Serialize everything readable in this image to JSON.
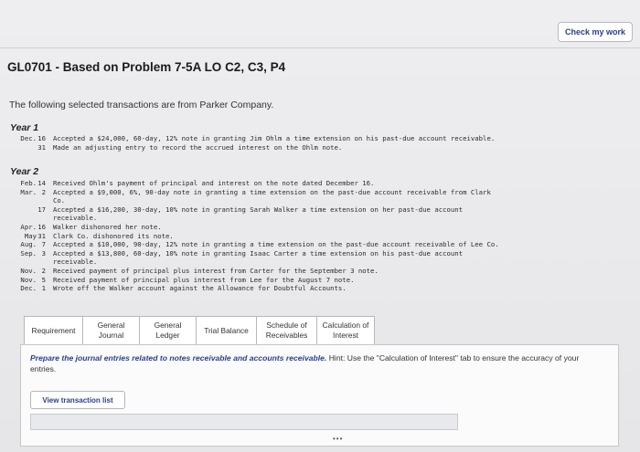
{
  "header": {
    "check_button": "Check my work"
  },
  "title": "GL0701 - Based on Problem 7-5A LO C2, C3, P4",
  "intro": "The following selected transactions are from Parker Company.",
  "year1": {
    "label": "Year 1",
    "rows": [
      {
        "month": "Dec.",
        "day": "16",
        "text": "Accepted a $24,000, 60-day, 12% note in granting Jim Ohlm a time extension on his past-due account receivable."
      },
      {
        "month": "",
        "day": "31",
        "text": "Made an adjusting entry to record the accrued interest on the Ohlm note."
      }
    ]
  },
  "year2": {
    "label": "Year 2",
    "rows": [
      {
        "month": "Feb.",
        "day": "14",
        "text": "Received Ohlm's payment of principal and interest on the note dated December 16."
      },
      {
        "month": "Mar.",
        "day": "2",
        "text": "Accepted a $9,000, 6%, 90-day note in granting a time extension on the past-due account receivable from Clark"
      },
      {
        "month": "",
        "day": "",
        "text": "Co."
      },
      {
        "month": "",
        "day": "17",
        "text": "Accepted a $16,200, 30-day, 10% note in granting Sarah Walker a time extension on her past-due account"
      },
      {
        "month": "",
        "day": "",
        "text": "receivable."
      },
      {
        "month": "Apr.",
        "day": "16",
        "text": "Walker dishonored her note."
      },
      {
        "month": "May",
        "day": "31",
        "text": "Clark Co. dishonored its note."
      },
      {
        "month": "Aug.",
        "day": "7",
        "text": "Accepted a $10,000, 90-day, 12% note in granting a time extension on the past-due account receivable of Lee Co."
      },
      {
        "month": "Sep.",
        "day": "3",
        "text": "Accepted a $13,800, 60-day, 10% note in granting Isaac Carter a time extension on his past-due account"
      },
      {
        "month": "",
        "day": "",
        "text": "receivable."
      },
      {
        "month": "Nov.",
        "day": "2",
        "text": "Received payment of principal plus interest from Carter for the September 3 note."
      },
      {
        "month": "Nov.",
        "day": "5",
        "text": "Received payment of principal plus interest from Lee for the August 7 note."
      },
      {
        "month": "Dec.",
        "day": "1",
        "text": "Wrote off the Walker account against the Allowance for Doubtful Accounts."
      }
    ]
  },
  "tabs": [
    {
      "label": "Requirement"
    },
    {
      "label": "General\nJournal"
    },
    {
      "label": "General\nLedger"
    },
    {
      "label": "Trial Balance"
    },
    {
      "label": "Schedule of\nReceivables"
    },
    {
      "label": "Calculation of\nInterest"
    }
  ],
  "panel": {
    "instruction_bold": "Prepare the journal entries related to notes receivable and accounts receivable.",
    "instruction_rest": " Hint: Use the \"Calculation of Interest\" tab to ensure the accuracy of your entries.",
    "view_button": "View transaction list",
    "dots": "•••"
  }
}
